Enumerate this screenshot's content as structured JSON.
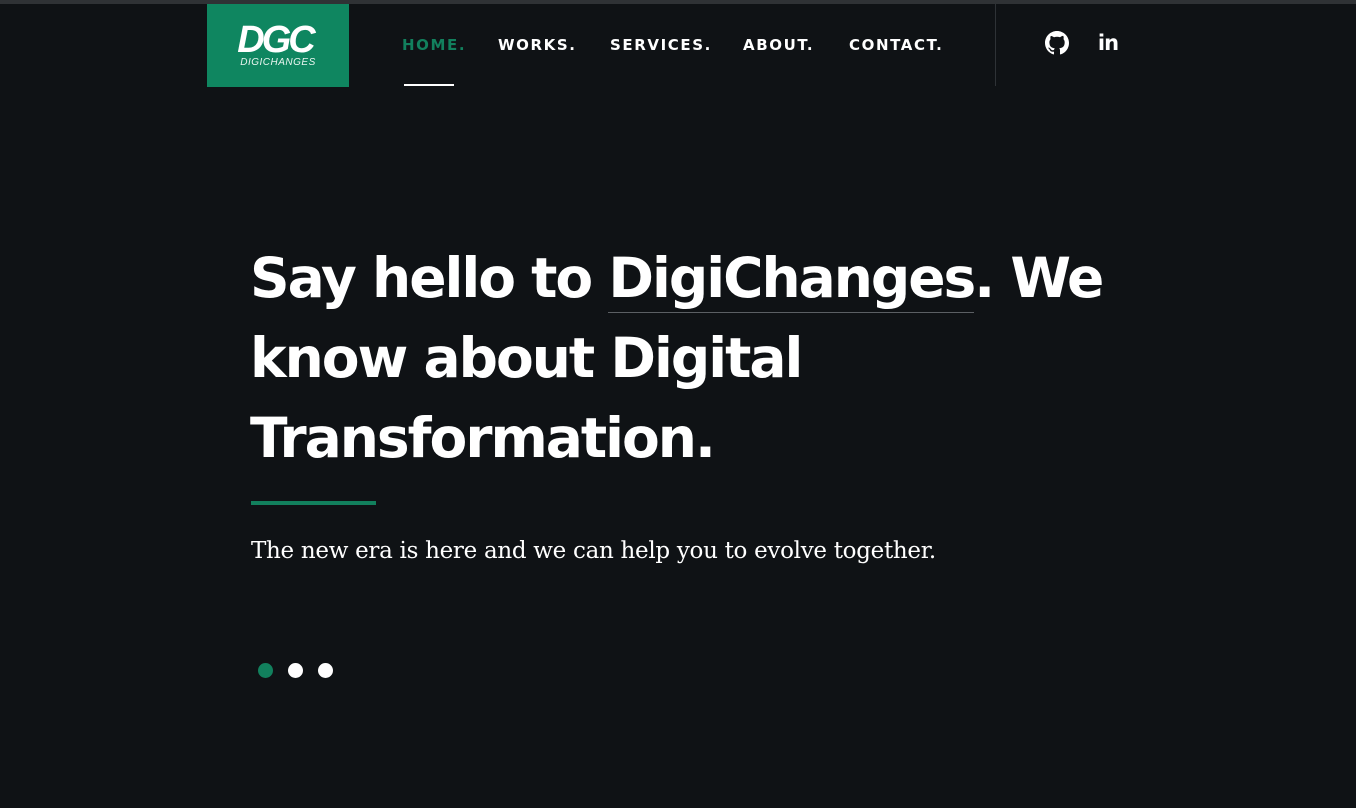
{
  "brand": {
    "logo_mark": "DGC",
    "logo_text": "DIGICHANGES",
    "logo_color": "#0f8660"
  },
  "nav": {
    "items": [
      {
        "label": "HOME.",
        "active": true
      },
      {
        "label": "WORKS.",
        "active": false
      },
      {
        "label": "SERVICES.",
        "active": false
      },
      {
        "label": "ABOUT.",
        "active": false
      },
      {
        "label": "CONTACT.",
        "active": false
      }
    ],
    "active_color": "#12805d"
  },
  "social": {
    "icons": [
      "github-icon",
      "linkedin-icon"
    ],
    "linkedin_label": "in"
  },
  "hero": {
    "headline_pre": "Say hello to ",
    "headline_brand": "DigiChanges",
    "headline_post": ". We know about Digital Transformation.",
    "subtext": "The new era is here and we can help you to evolve together.",
    "slider": {
      "total": 3,
      "active": 1
    }
  },
  "colors": {
    "background": "#0f1215",
    "accent": "#12805d",
    "text": "#ffffff"
  }
}
